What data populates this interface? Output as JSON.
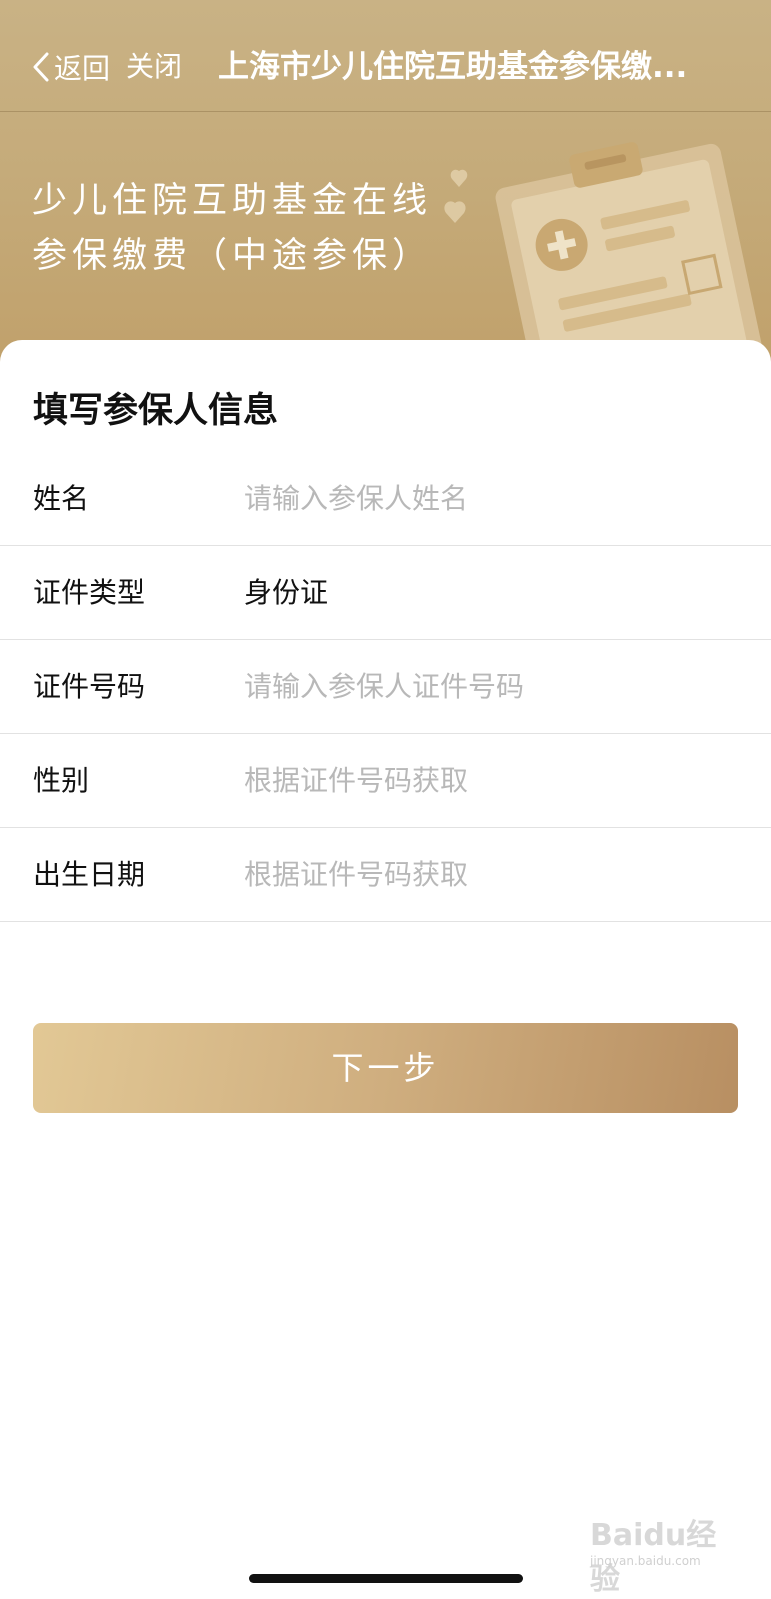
{
  "nav": {
    "back_label": "返回",
    "close_label": "关闭",
    "title": "上海市少儿住院互助基金参保缴..."
  },
  "banner": {
    "line1": "少儿住院互助基金在线",
    "line2": "参保缴费（中途参保）"
  },
  "form": {
    "title": "填写参保人信息",
    "fields": [
      {
        "label": "姓名",
        "value": "",
        "placeholder": "请输入参保人姓名"
      },
      {
        "label": "证件类型",
        "value": "身份证",
        "placeholder": ""
      },
      {
        "label": "证件号码",
        "value": "",
        "placeholder": "请输入参保人证件号码"
      },
      {
        "label": "性别",
        "value": "",
        "placeholder": "根据证件号码获取"
      },
      {
        "label": "出生日期",
        "value": "",
        "placeholder": "根据证件号码获取"
      }
    ],
    "next_label": "下一步"
  },
  "watermark": {
    "brand": "Baidu经验",
    "url": "jingyan.baidu.com"
  },
  "colors": {
    "header_gold": "#c5ab7a",
    "button_start": "#e2c895",
    "button_end": "#b88f62",
    "placeholder": "#b8b8b8"
  }
}
